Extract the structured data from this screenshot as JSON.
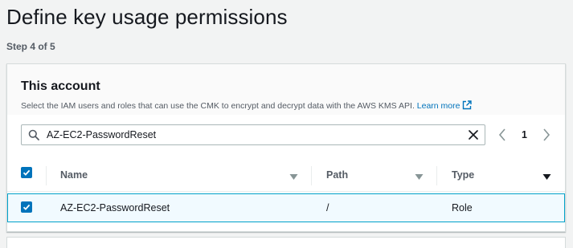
{
  "page": {
    "title": "Define key usage permissions",
    "step": "Step 4 of 5"
  },
  "panel": {
    "title": "This account",
    "description": "Select the IAM users and roles that can use the CMK to encrypt and decrypt data with the AWS KMS API.",
    "learn_more": "Learn more"
  },
  "search": {
    "value": "AZ-EC2-PasswordReset"
  },
  "pagination": {
    "current_page": "1"
  },
  "table": {
    "columns": [
      {
        "label": "Name"
      },
      {
        "label": "Path"
      },
      {
        "label": "Type"
      }
    ],
    "rows": [
      {
        "name": "AZ-EC2-PasswordReset",
        "path": "/",
        "type": "Role",
        "selected": true
      }
    ],
    "select_all_checked": true
  },
  "colors": {
    "accent": "#0073bb",
    "selected_row_bg": "#f1faff",
    "selected_row_border": "#00a1c9"
  },
  "icons": [
    "search-icon",
    "clear-icon",
    "chevron-left-icon",
    "chevron-right-icon",
    "external-link-icon",
    "sort-icon",
    "checkmark-icon"
  ]
}
